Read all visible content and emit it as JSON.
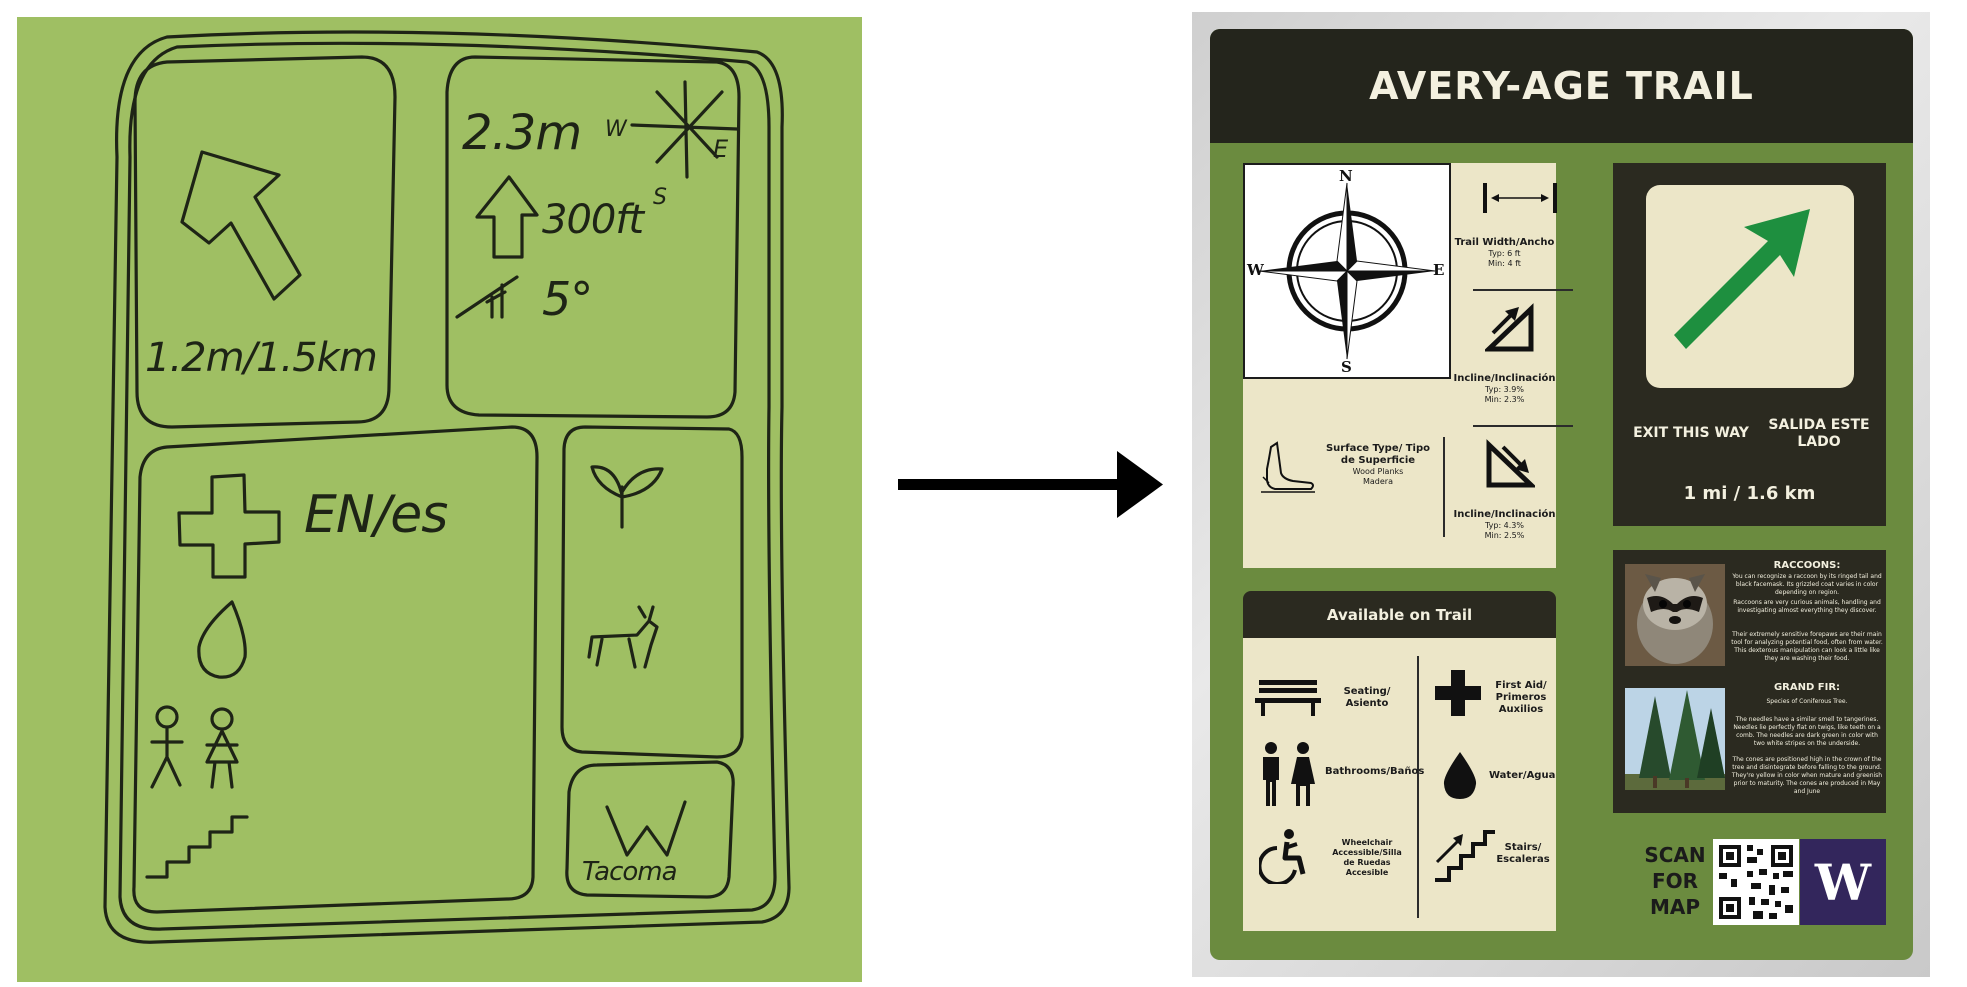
{
  "sketch": {
    "distance": "1.2m/1.5km",
    "length": "2.3m",
    "elevation": "300ft",
    "grade": "5°",
    "compass": {
      "w": "W",
      "e": "E",
      "s": "S"
    },
    "language": "EN/es",
    "logo_letter": "W",
    "logo_text": "Tacoma"
  },
  "sign": {
    "title": "AVERY-AGE TRAIL",
    "compass": {
      "n": "N",
      "s": "S",
      "e": "E",
      "w": "W"
    },
    "trail_width": {
      "title": "Trail Width/Ancho",
      "typ": "Typ: 6 ft",
      "min": "Min: 4 ft"
    },
    "incline_up": {
      "title": "Incline/Inclinación",
      "typ": "Typ: 3.9%",
      "min": "Min: 2.3%"
    },
    "incline_down": {
      "title": "Incline/Inclinación",
      "typ": "Typ: 4.3%",
      "min": "Min: 2.5%"
    },
    "surface": {
      "title": "Surface Type/ Tipo de Superficie",
      "value": "Wood Planks",
      "value_es": "Madera"
    },
    "available": {
      "title": "Available on Trail",
      "seating": "Seating/ Asiento",
      "first_aid": "First Aid/ Primeros Auxilios",
      "bathrooms": "Bathrooms/Baños",
      "water": "Water/Agua",
      "wheelchair": "Wheelchair Accessible/Silla de Ruedas Accesible",
      "stairs": "Stairs/ Escaleras"
    },
    "exit": {
      "en": "EXIT THIS WAY",
      "es": "SALIDA ESTE LADO",
      "distance": "1 mi / 1.6 km"
    },
    "species": {
      "raccoon_title": "RACCOONS:",
      "raccoon_p1": "You can recognize a raccoon by its ringed tail and black facemask. Its grizzled coat varies in color depending on region.",
      "raccoon_p2": "Raccoons are very curious animals, handling and investigating almost everything they discover.",
      "raccoon_p3": "Their extremely sensitive forepaws are their main tool for analyzing potential food, often from water. This dexterous manipulation can look a little like they are washing their food.",
      "fir_title": "GRAND FIR:",
      "fir_p1": "Species of Coniferous Tree.",
      "fir_p2": "The needles have a similar smell to tangerines. Needles lie perfectly flat on twigs, like teeth on a comb. The needles are dark green in color with two white stripes on the underside.",
      "fir_p3": "The cones are positioned high in the crown of the tree and disintegrate before falling to the ground. They're yellow in color when mature and greenish prior to maturity. The cones are produced in May and June"
    },
    "scan": "SCAN FOR MAP",
    "uw_letter": "W"
  },
  "colors": {
    "sign_green": "#6b8b3f",
    "sign_dark": "#24251c",
    "cream": "#ece6c8",
    "exit_arrow": "#1e8f3f",
    "uw_purple": "#33265c",
    "sketch_green": "#9fbf63"
  }
}
